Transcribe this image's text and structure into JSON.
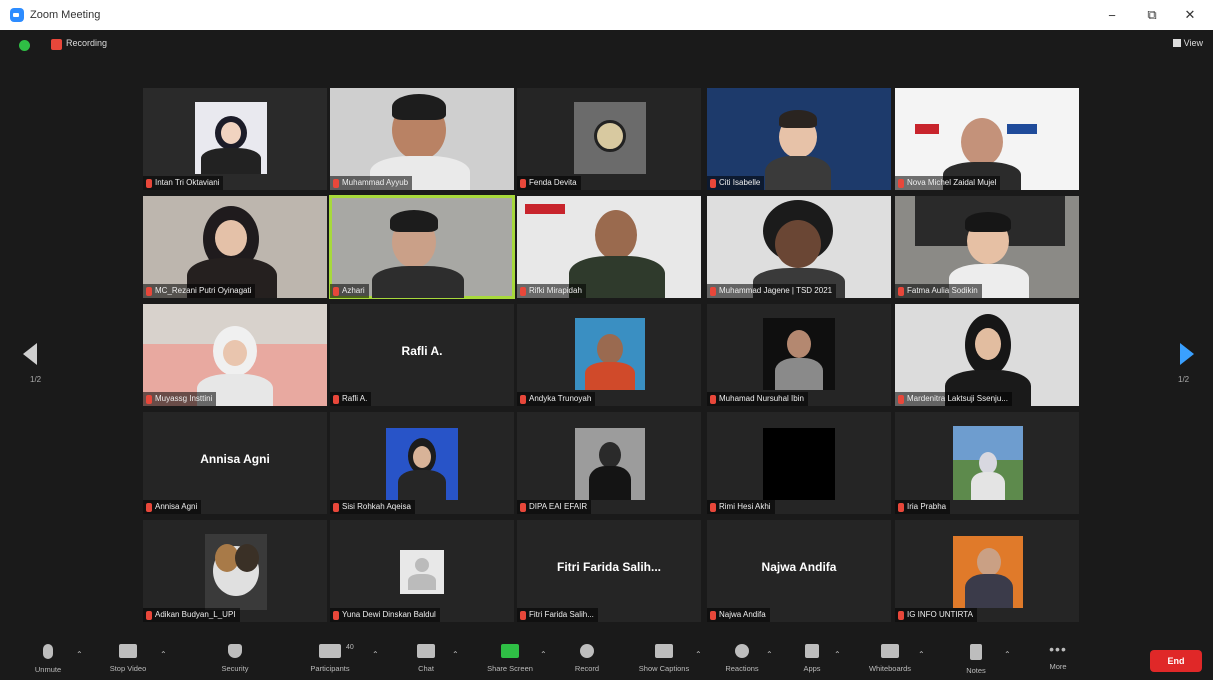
{
  "window": {
    "title": "Zoom Meeting",
    "minimize": "−",
    "restore": "⧉",
    "close": "✕"
  },
  "topbar": {
    "recording_label": "Recording",
    "view_label": "View"
  },
  "nav": {
    "prev_page": "1/2",
    "next_page": "1/2"
  },
  "participants": [
    {
      "name": "Intan Tri Oktaviani"
    },
    {
      "name": "Muhammad Ayyub"
    },
    {
      "name": "Fenda Devita"
    },
    {
      "name": "Citi Isabelle"
    },
    {
      "name": "Nova Michel Zaidal Mujel"
    },
    {
      "name": "MC_Rezani Putri Oyinagati"
    },
    {
      "name": "Azhari"
    },
    {
      "name": "Rifki Mirapidah"
    },
    {
      "name": "Muhammad Jagene | TSD 2021"
    },
    {
      "name": "Fatma Aulia Sodikin"
    },
    {
      "name": "Muyassg Insttini"
    },
    {
      "name": "Rafli A.",
      "display": "Rafli A."
    },
    {
      "name": "Andyka Trunoyah"
    },
    {
      "name": "Muhamad Nursuhal Ibin"
    },
    {
      "name": "Mardenitra Laktsuji Ssenju..."
    },
    {
      "name": "Annisa Agni",
      "display": "Annisa Agni"
    },
    {
      "name": "Sisi Rohkah Aqeisa"
    },
    {
      "name": "DIPA EAI EFAIR"
    },
    {
      "name": "Rimi Hesi Akhi"
    },
    {
      "name": "Iria Prabha"
    },
    {
      "name": "Adikan Budyan_L_UPI"
    },
    {
      "name": "Yuna Dewi Dinskan Baldul"
    },
    {
      "name": "Fitri Farida Salih...",
      "display": "Fitri Farida Salih..."
    },
    {
      "name": "Najwa Andifa",
      "display": "Najwa Andifa"
    },
    {
      "name": "IG INFO UNTIRTA"
    }
  ],
  "toolbar": [
    {
      "label": "Unmute",
      "icon": "microphone-muted-icon"
    },
    {
      "label": "Stop Video",
      "icon": "video-camera-icon"
    },
    {
      "label": "Security",
      "icon": "shield-icon"
    },
    {
      "label": "Participants",
      "icon": "participants-icon",
      "count": "40"
    },
    {
      "label": "Chat",
      "icon": "chat-icon"
    },
    {
      "label": "Share Screen",
      "icon": "share-screen-icon"
    },
    {
      "label": "Record",
      "icon": "record-icon"
    },
    {
      "label": "Show Captions",
      "icon": "captions-icon"
    },
    {
      "label": "Reactions",
      "icon": "reactions-icon"
    },
    {
      "label": "Apps",
      "icon": "apps-icon"
    },
    {
      "label": "Whiteboards",
      "icon": "whiteboard-icon"
    },
    {
      "label": "Notes",
      "icon": "notes-icon"
    },
    {
      "label": "More",
      "icon": "more-icon"
    }
  ],
  "end_label": "End",
  "colors": {
    "accent": "#2d8cff",
    "active_speaker": "#a7d93b",
    "end": "#e02828",
    "share": "#2fbf45"
  }
}
